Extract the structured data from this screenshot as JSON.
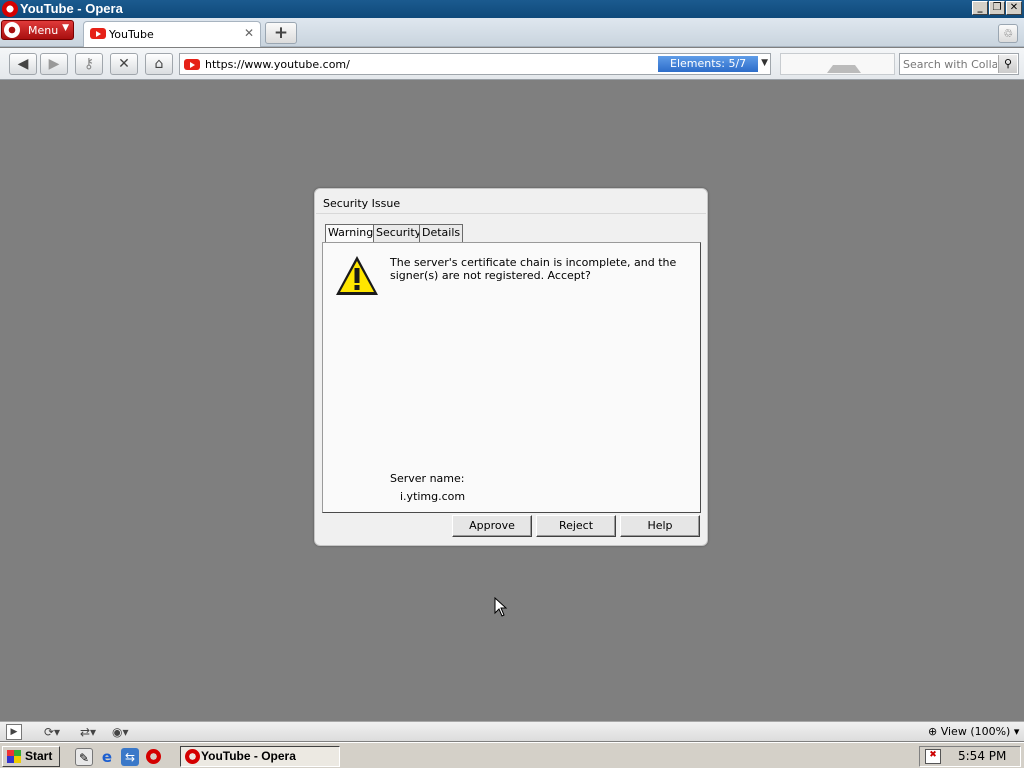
{
  "window": {
    "title": "YouTube - Opera",
    "minimize_glyph": "_",
    "restore_glyph": "❐",
    "close_glyph": "✕"
  },
  "tabstrip": {
    "menu_label": "Menu",
    "tabs": [
      {
        "label": "YouTube",
        "close_glyph": "✕"
      }
    ],
    "new_tab_glyph": "+"
  },
  "toolbar": {
    "url": "https://www.youtube.com/",
    "elements_label": "Elements:  5/7",
    "search_placeholder": "Search with Collab"
  },
  "dialog": {
    "title": "Security Issue",
    "tabs": [
      "Warning",
      "Security",
      "Details"
    ],
    "active_tab": "Warning",
    "message": "The server's certificate chain is incomplete, and the signer(s) are not registered. Accept?",
    "server_name_label": "Server name:",
    "server_name_value": "i.ytimg.com",
    "buttons": {
      "approve": "Approve",
      "reject": "Reject",
      "help": "Help"
    }
  },
  "statusbar": {
    "view_label": "View (100%)"
  },
  "taskbar": {
    "start_label": "Start",
    "active_task": "YouTube - Opera",
    "clock": "5:54 PM"
  },
  "colors": {
    "title_bar": "#1b5a8f",
    "menu_button": "#c41e1e",
    "elements_badge": "#3d7fd8",
    "youtube_red": "#e62117",
    "page_background": "#7f7f7f",
    "warning_yellow": "#ffe600"
  },
  "icons": {
    "back": "arrow-left-icon",
    "forward": "arrow-right-icon",
    "key": "key-icon",
    "stop": "close-icon",
    "home": "home-icon",
    "search": "magnifier-icon",
    "warning": "warning-triangle-icon",
    "trash": "trash-icon"
  }
}
